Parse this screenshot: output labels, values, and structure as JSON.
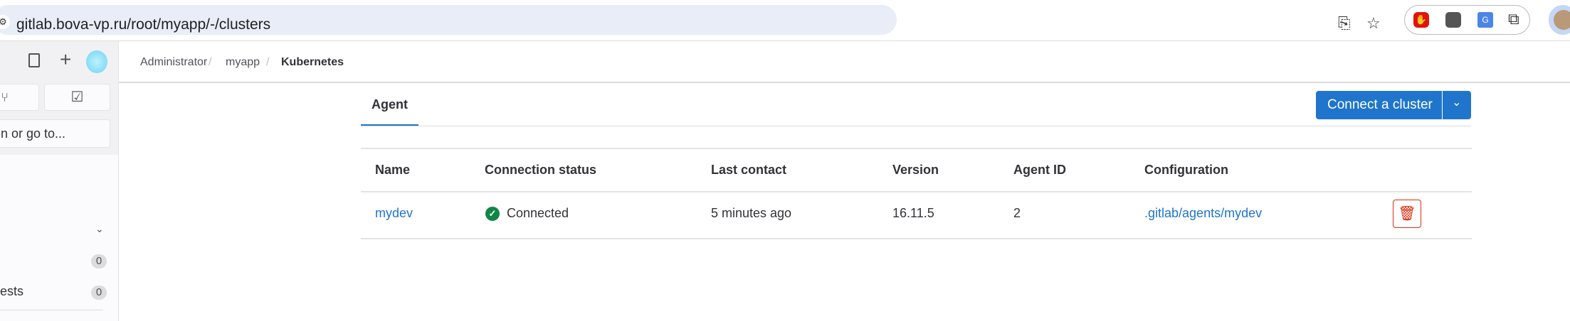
{
  "browser": {
    "url": "gitlab.bova-vp.ru/root/myapp/-/clusters"
  },
  "sidebar": {
    "search_placeholder": "n or go to...",
    "items": [
      {
        "label": "",
        "count": "0"
      },
      {
        "label": "ests",
        "count": "0"
      }
    ]
  },
  "breadcrumb": [
    "Administrator",
    "myapp",
    "Kubernetes"
  ],
  "tabs": [
    {
      "label": "Agent",
      "active": true
    }
  ],
  "connect_button": "Connect a cluster",
  "table": {
    "headers": [
      "Name",
      "Connection status",
      "Last contact",
      "Version",
      "Agent ID",
      "Configuration"
    ],
    "rows": [
      {
        "name": "mydev",
        "status": "Connected",
        "last_contact": "5 minutes ago",
        "version": "16.11.5",
        "agent_id": "2",
        "configuration": ".gitlab/agents/mydev"
      }
    ]
  },
  "colors": {
    "accent": "#1f75cb",
    "success": "#108548",
    "danger": "#dd2b0e"
  }
}
